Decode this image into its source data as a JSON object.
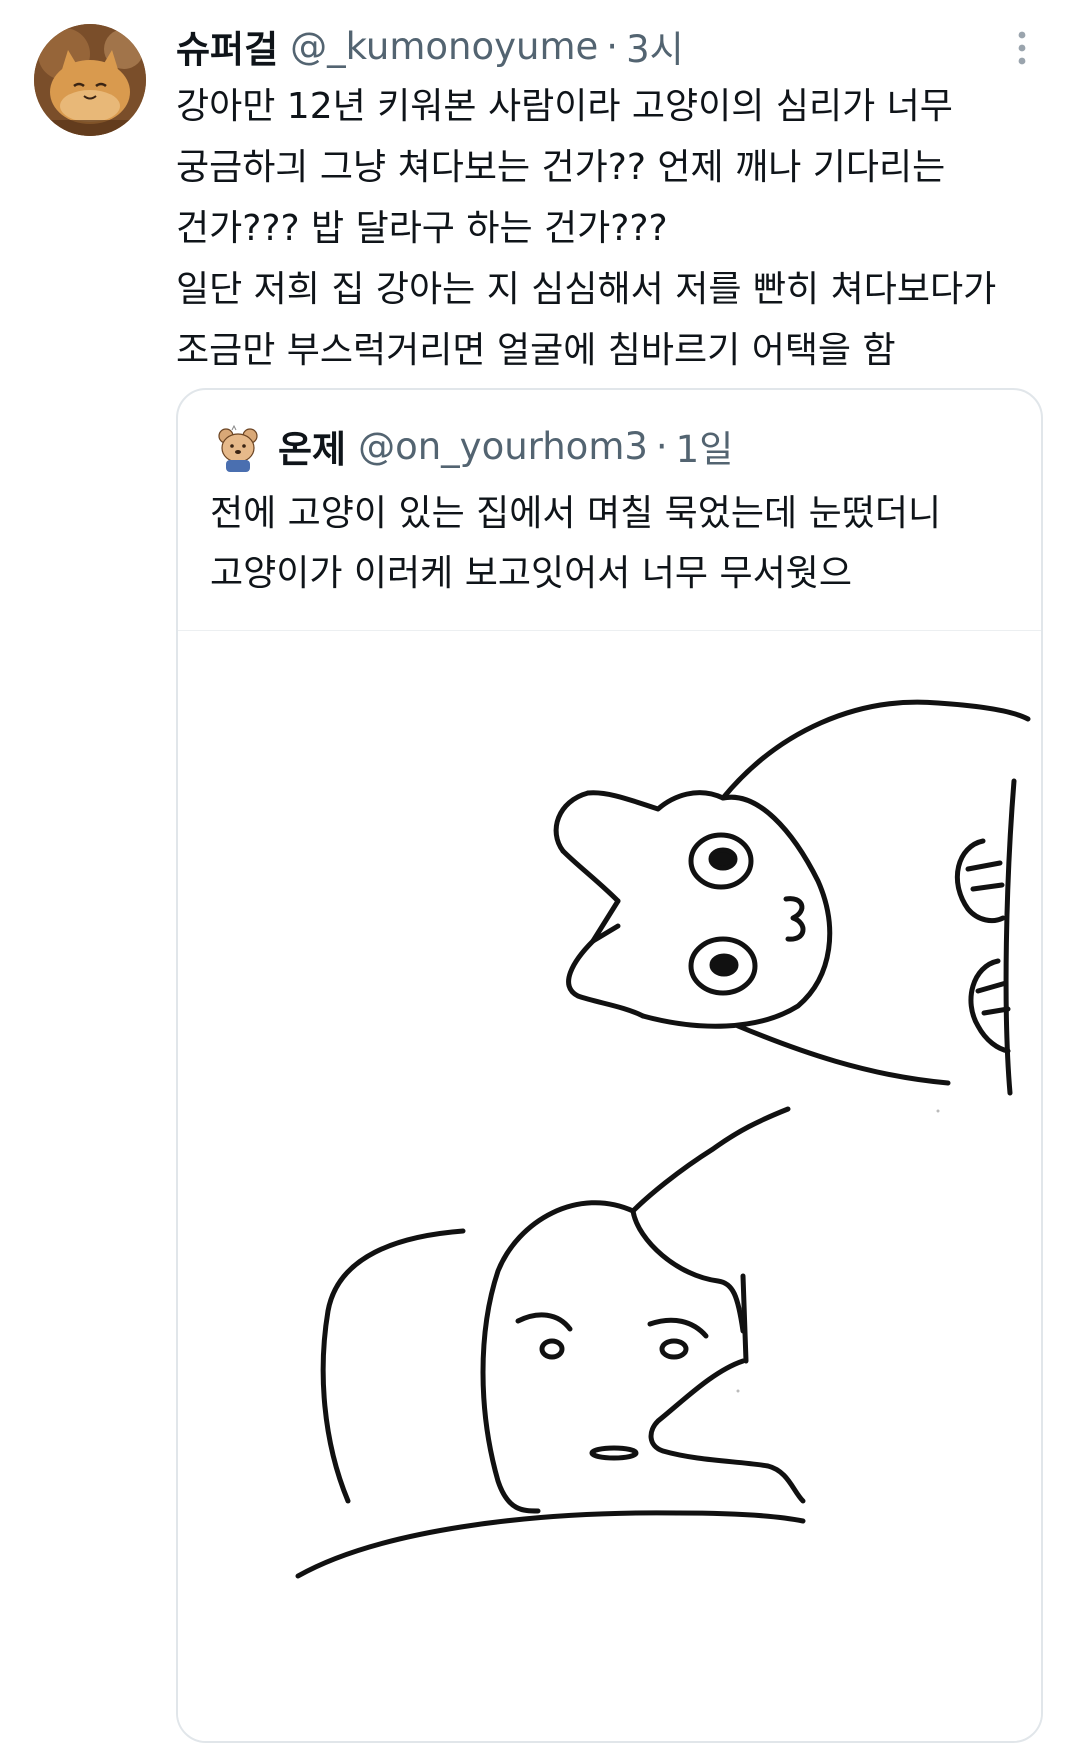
{
  "tweet": {
    "author": {
      "display_name": "슈퍼걸",
      "handle": "@_kumonoyume",
      "separator": "·",
      "time": "3시",
      "avatar_icon": "cat-plush-photo-avatar"
    },
    "menu_icon": "more-vertical-icon",
    "text_lines": [
      "강아만 12년 키워본 사람이라 고양이의 심리가 너무",
      "궁금하긔 그냥 쳐다보는 건가?? 언제 깨나 기다리는",
      "건가??? 밥 달라구 하는 건가???",
      "일단 저희 집 강아는 지 심심해서 저를 빤히 쳐다보다가",
      "조금만 부스럭거리면 얼굴에 침바르기 어택을 함"
    ],
    "quoted_tweet": {
      "author": {
        "display_name": "온제",
        "handle": "@on_yourhom3",
        "separator": "·",
        "time": "1일",
        "avatar_icon": "bear-cartoon-avatar"
      },
      "text_lines": [
        "전에 고양이 있는 집에서 며칠 묵었는데 눈떴더니",
        "고양이가 이러케 보고잇어서 너무 무서웟으"
      ],
      "media": {
        "type": "drawing",
        "description_icon": "cat-staring-at-sleeping-person-drawing"
      }
    }
  },
  "colors": {
    "text_primary": "#0f1419",
    "text_secondary": "#536471",
    "border": "#e1e6ea",
    "background": "#ffffff"
  }
}
